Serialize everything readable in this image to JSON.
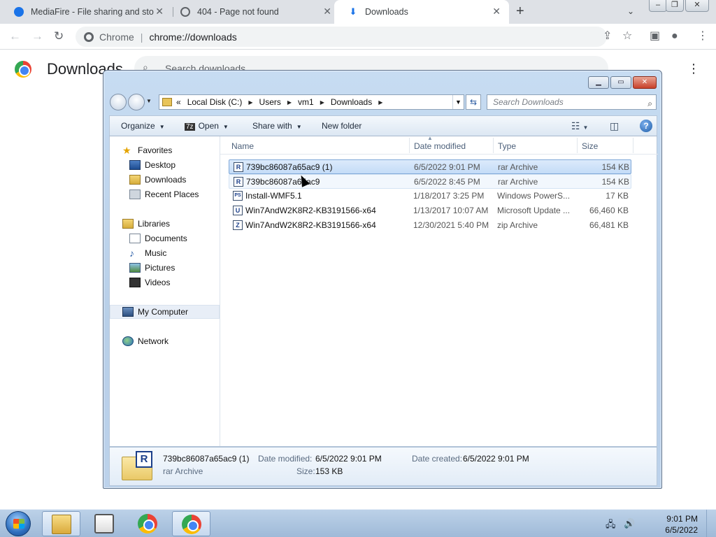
{
  "browser": {
    "tabs": [
      {
        "title": "MediaFire - File sharing and stor",
        "icon": "mediafire-icon"
      },
      {
        "title": "404 - Page not found",
        "icon": "globe-icon"
      },
      {
        "title": "Downloads",
        "icon": "download-icon"
      }
    ],
    "active_tab": 2,
    "omnibox": {
      "site": "Chrome",
      "url": "chrome://downloads"
    },
    "page": {
      "title": "Downloads",
      "search_placeholder": "Search downloads"
    }
  },
  "explorer": {
    "breadcrumb": [
      "«",
      "Local Disk (C:)",
      "Users",
      "vm1",
      "Downloads"
    ],
    "search_placeholder": "Search Downloads",
    "commands": {
      "organize": "Organize",
      "open": "Open",
      "share_with": "Share with",
      "new_folder": "New folder"
    },
    "nav": {
      "favorites": "Favorites",
      "desktop": "Desktop",
      "downloads": "Downloads",
      "recent": "Recent Places",
      "libraries": "Libraries",
      "documents": "Documents",
      "music": "Music",
      "pictures": "Pictures",
      "videos": "Videos",
      "computer": "My Computer",
      "network": "Network"
    },
    "columns": {
      "name": "Name",
      "date": "Date modified",
      "type": "Type",
      "size": "Size"
    },
    "files": [
      {
        "name": "739bc86087a65ac9 (1)",
        "date": "6/5/2022 9:01 PM",
        "type": "rar Archive",
        "size": "154 KB",
        "icon": "R"
      },
      {
        "name": "739bc86087a65ac9",
        "date": "6/5/2022 8:45 PM",
        "type": "rar Archive",
        "size": "154 KB",
        "icon": "R"
      },
      {
        "name": "Install-WMF5.1",
        "date": "1/18/2017 3:25 PM",
        "type": "Windows PowerS...",
        "size": "17 KB",
        "icon": "PS"
      },
      {
        "name": "Win7AndW2K8R2-KB3191566-x64",
        "date": "1/13/2017 10:07 AM",
        "type": "Microsoft Update ...",
        "size": "66,460 KB",
        "icon": "U"
      },
      {
        "name": "Win7AndW2K8R2-KB3191566-x64",
        "date": "12/30/2021 5:40 PM",
        "type": "zip Archive",
        "size": "66,481 KB",
        "icon": "Z"
      }
    ],
    "details": {
      "name": "739bc86087a65ac9 (1)",
      "type": "rar Archive",
      "modified_label": "Date modified:",
      "modified": "6/5/2022 9:01 PM",
      "created_label": "Date created:",
      "created": "6/5/2022 9:01 PM",
      "size_label": "Size:",
      "size": "153 KB",
      "icon_letter": "R"
    }
  },
  "taskbar": {
    "clock_time": "9:01 PM",
    "clock_date": "6/5/2022"
  }
}
